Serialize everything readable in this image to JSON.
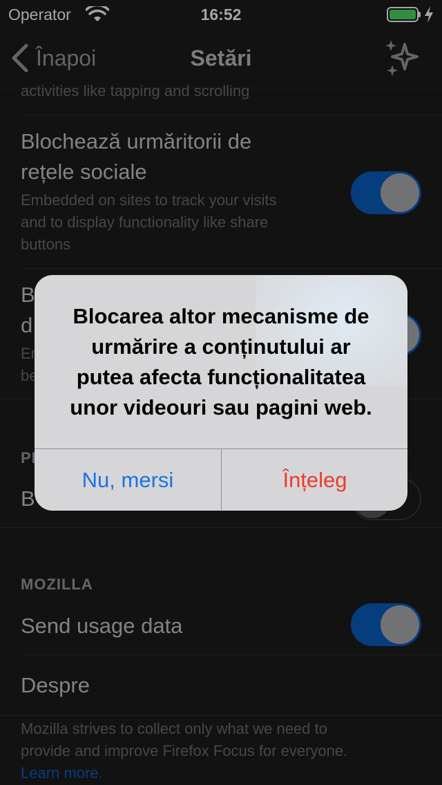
{
  "status_bar": {
    "carrier": "Operator",
    "time": "16:52",
    "battery_color": "#4cd964"
  },
  "nav": {
    "back_label": "Înapoi",
    "title": "Setări",
    "back_icon": "chevron-left-icon",
    "right_icon": "sparkle-icon"
  },
  "list": {
    "partial_subtitle": "activities like tapping and scrolling",
    "social": {
      "title_line1": "Blochează urmăritorii de",
      "title_line2": "rețele sociale",
      "sub_line1": "Embedded on sites to track your visits",
      "sub_line2": "and to display functionality like share",
      "sub_line3": "buttons",
      "enabled": true
    },
    "other_content": {
      "title_line1_visible": "B",
      "title_line2_visible": "d",
      "sub_line1_visible": "Er",
      "sub_line2_visible": "be",
      "enabled": true
    },
    "perf_section": {
      "header_visible": "PE",
      "row_title_visible": "B",
      "enabled": false
    },
    "mozilla_section": {
      "header": "MOZILLA",
      "send_usage_label": "Send usage data",
      "send_usage_enabled": true,
      "about_label": "Despre"
    },
    "footer": {
      "line1": "Mozilla strives to collect only what we need to",
      "line2": "provide and improve Firefox Focus for everyone.",
      "link": "Learn more.",
      "link_color": "#0a5fbf"
    }
  },
  "alert": {
    "line1": "Blocarea altor mecanisme de",
    "line2": "urmărire a conținutului ar",
    "line3": "putea afecta funcționalitatea",
    "line4": "unor videouri sau pagini web.",
    "cancel_label": "Nu, mersi",
    "confirm_label": "Înțeleg",
    "cancel_color": "#1a73e8",
    "confirm_color": "#ee3a2c"
  },
  "colors": {
    "background": "#1c1c1e",
    "toggle_on": "#0a5fbf"
  }
}
